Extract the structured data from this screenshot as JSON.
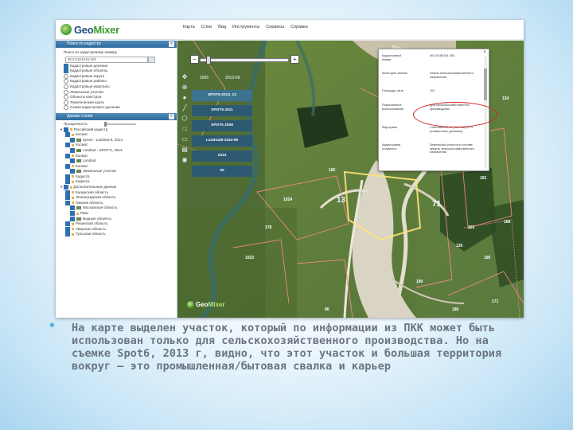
{
  "app": {
    "logo_word_1": "Geo",
    "logo_word_2": "Mixer",
    "menu": [
      "Карта",
      "Слои",
      "Вид",
      "Инструменты",
      "Сервисы",
      "Справка"
    ]
  },
  "sidebar": {
    "search_panel_title": "Поиск по кадастру",
    "search_hint": "Поиск по кадастровому номеру",
    "search_value": "06:3:018:0101:160",
    "search_options": [
      {
        "label": "Кадастровые деления",
        "on": true
      },
      {
        "label": "Кадастровые объекты",
        "on": true
      },
      {
        "label": "Кадастровые округа",
        "on": false
      },
      {
        "label": "Кадастровые районы",
        "on": false
      },
      {
        "label": "Кадастровые кварталы",
        "on": false
      },
      {
        "label": "Земельные участки",
        "on": false
      },
      {
        "label": "Объекты капстроя",
        "on": false
      },
      {
        "label": "Тематическая карта",
        "on": false
      },
      {
        "label": "Схема кадастрового деления",
        "on": false
      }
    ],
    "layers_panel_title": "Дерево слоев",
    "opacity_label": "Прозрачность",
    "layers": [
      {
        "label": "Российский кадастр",
        "kind": "folder",
        "indent": 0
      },
      {
        "label": "Космос",
        "kind": "check",
        "indent": 1
      },
      {
        "label": "Купол - Landsat-8, 2013",
        "kind": "layer",
        "indent": 2
      },
      {
        "label": "Космос",
        "kind": "check",
        "indent": 1
      },
      {
        "label": "Landsat - SPOT-5, 2013",
        "kind": "layer",
        "indent": 2
      },
      {
        "label": "Космос",
        "kind": "check",
        "indent": 1
      },
      {
        "label": "Landsat",
        "kind": "layer",
        "indent": 2
      },
      {
        "label": "Космос",
        "kind": "check",
        "indent": 1
      },
      {
        "label": "Земельные участки",
        "kind": "layer",
        "indent": 2
      },
      {
        "label": "Кадастр",
        "kind": "check",
        "indent": 1
      },
      {
        "label": "Кадастр",
        "kind": "check",
        "indent": 1
      },
      {
        "label": "Дополнительные данные",
        "kind": "folder",
        "indent": 0
      },
      {
        "label": "Калужская область",
        "kind": "check",
        "indent": 1
      },
      {
        "label": "Ленинградская область",
        "kind": "check",
        "indent": 1
      },
      {
        "label": "Омская область",
        "kind": "check",
        "indent": 1
      },
      {
        "label": "Московская область",
        "kind": "layer",
        "indent": 2
      },
      {
        "label": "Реки",
        "kind": "check",
        "indent": 2
      },
      {
        "label": "Водные объекты",
        "kind": "layer",
        "indent": 2
      },
      {
        "label": "Рязанская область",
        "kind": "check",
        "indent": 1
      },
      {
        "label": "Тверская область",
        "kind": "check",
        "indent": 1
      },
      {
        "label": "Тульская область",
        "kind": "check",
        "indent": 1
      }
    ]
  },
  "map": {
    "basemaps": [
      "SPOT6-2013_12",
      "SPOT5 2011",
      "SPOT5 2008",
      "Landsat8-1104-08",
      "2013",
      "20"
    ],
    "copyright_left": "2005",
    "copyright_right": "2013-09",
    "parcel_labels": [
      "13",
      "71",
      "1024",
      "191",
      "168",
      "171",
      "135",
      "190",
      "195",
      "186",
      "165",
      "178",
      "86",
      "134",
      "1023",
      "163"
    ],
    "popup": {
      "rows": [
        {
          "key": "Кадастровый номер",
          "value": "06:3:0180101:160"
        },
        {
          "key": "Категория земель",
          "value": "Земли сельскохозяйственного назначения"
        },
        {
          "key": "Площадь, кв.м",
          "value": "101"
        },
        {
          "key": "Разрешенное использование",
          "value": "Для сельскохозяйственного производства"
        },
        {
          "key": "Вид права",
          "value": "Собственность (частная) в т.ч. (совместная, долевая)"
        },
        {
          "key": "Кадастровая стоимость",
          "value": "Земельный участок в составе земель сельскохозяйственного назначения"
        }
      ]
    }
  },
  "caption": {
    "lines": [
      "На карте выделен участок, который по информации из ПКК может быть",
      "использован только для сельскохозяйственного производства. Но на",
      "съемке Spot6, 2013 г, видно, что этот участок и большая территория",
      "вокруг — это промышленная/бытовая свалка и карьер"
    ]
  },
  "colors": {
    "accent": "#2e6a9c",
    "highlight_ring": "#d42222",
    "caption_text": "#6c7682",
    "bullet": "#2f95d8",
    "parcel_outline": "#ff8a8a"
  }
}
